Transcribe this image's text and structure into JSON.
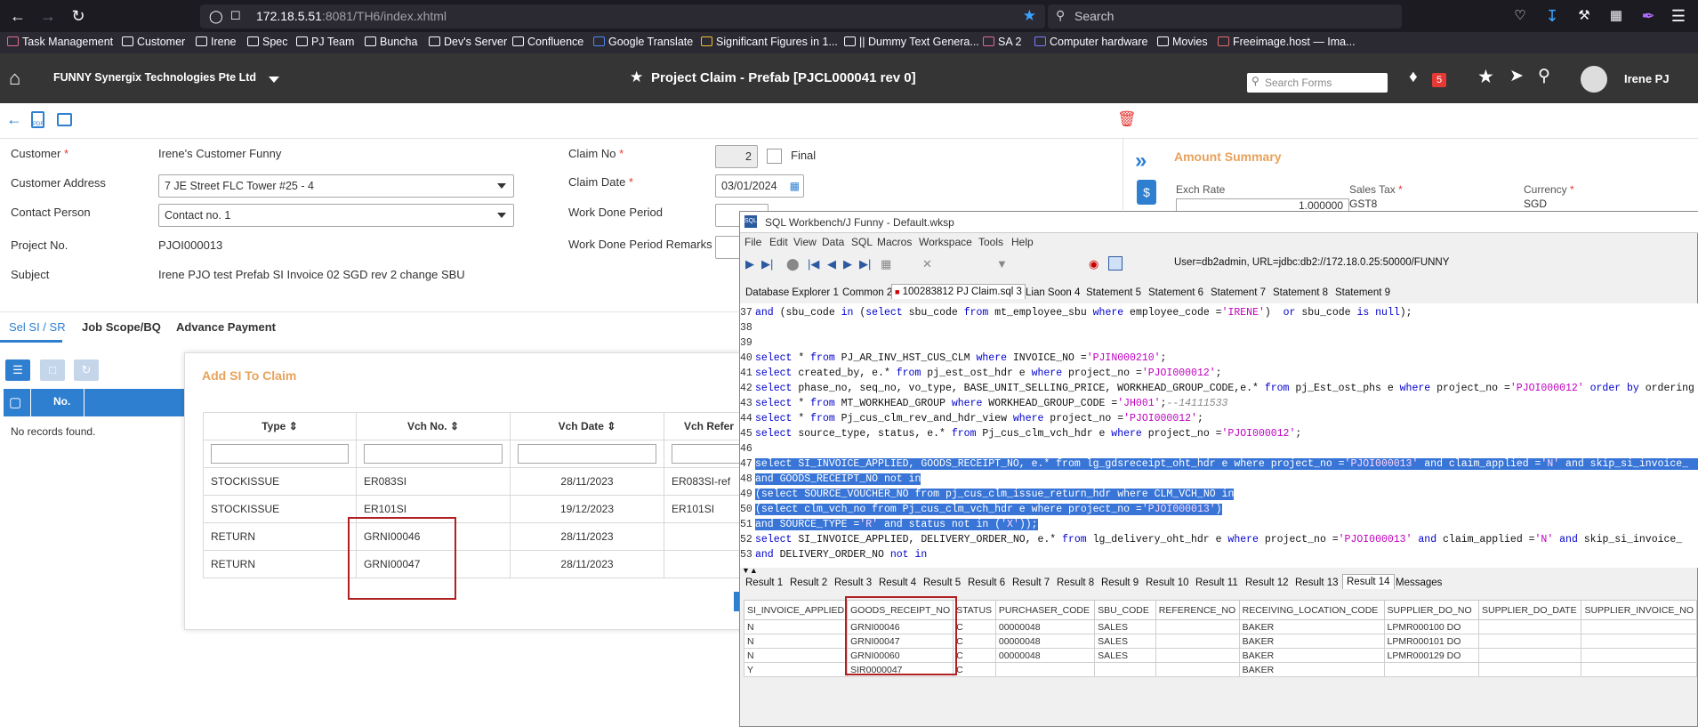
{
  "browser": {
    "url_host": "172.18.5.51",
    "url_path": ":8081/TH6/index.xhtml",
    "search_placeholder": "Search",
    "bookmarks": [
      "Task Management",
      "Customer",
      "Irene",
      "Spec",
      "PJ Team",
      "Buncha",
      "Dev's Server",
      "Confluence",
      "Google Translate",
      "Significant Figures in 1...",
      "|| Dummy Text Genera...",
      "SA 2",
      "Computer hardware",
      "Movies",
      "Freeimage.host — Ima..."
    ]
  },
  "app": {
    "company": "FUNNY Synergix Technologies Pte Ltd",
    "title": "Project Claim - Prefab [PJCL000041 rev 0]",
    "search_forms_placeholder": "Search Forms",
    "notif_count": "5",
    "user": "Irene PJ"
  },
  "form": {
    "customer_label": "Customer",
    "customer_value": "Irene's Customer Funny",
    "address_label": "Customer Address",
    "address_value": "7 JE Street FLC Tower #25 - 4",
    "contact_label": "Contact Person",
    "contact_value": "Contact no. 1",
    "project_label": "Project No.",
    "project_value": "PJOI000013",
    "subject_label": "Subject",
    "subject_value": "Irene PJO test Prefab SI Invoice 02 SGD rev 2 change SBU",
    "claim_no_label": "Claim No",
    "claim_no_value": "2",
    "final_label": "Final",
    "claim_date_label": "Claim Date",
    "claim_date_value": "03/01/2024",
    "wdp_label": "Work Done Period",
    "wdp_remarks_label": "Work Done Period Remarks"
  },
  "amount_summary": {
    "title": "Amount Summary",
    "exch_rate_label": "Exch Rate",
    "exch_rate_value": "1.000000",
    "sales_tax_label": "Sales Tax",
    "sales_tax_value": "GST8",
    "currency_label": "Currency",
    "currency_value": "SGD"
  },
  "tabs": [
    "Sel SI / SR",
    "Job Scope/BQ",
    "Advance Payment"
  ],
  "left_grid": {
    "col_no": "No.",
    "empty": "No records found."
  },
  "dialog": {
    "title": "Add SI To Claim",
    "columns": [
      "Type",
      "Vch No.",
      "Vch Date",
      "Vch Refer"
    ],
    "rows": [
      [
        "STOCKISSUE",
        "ER083SI",
        "28/11/2023",
        "ER083SI-ref"
      ],
      [
        "STOCKISSUE",
        "ER101SI",
        "19/12/2023",
        "ER101SI"
      ],
      [
        "RETURN",
        "GRNI00046",
        "28/11/2023",
        ""
      ],
      [
        "RETURN",
        "GRNI00047",
        "28/11/2023",
        ""
      ]
    ]
  },
  "workbench": {
    "title": "SQL Workbench/J Funny - Default.wksp",
    "menu": [
      "File",
      "Edit",
      "View",
      "Data",
      "SQL",
      "Macros",
      "Workspace",
      "Tools",
      "Help"
    ],
    "conn": "User=db2admin, URL=jdbc:db2://172.18.0.25:50000/FUNNY",
    "tabs": [
      "Database Explorer 1",
      "Common 2",
      "100283812 PJ Claim.sql 3",
      "Lian Soon 4",
      "Statement 5",
      "Statement 6",
      "Statement 7",
      "Statement 8",
      "Statement 9"
    ],
    "result_tabs": [
      "Result 1",
      "Result 2",
      "Result 3",
      "Result 4",
      "Result 5",
      "Result 6",
      "Result 7",
      "Result 8",
      "Result 9",
      "Result 10",
      "Result 11",
      "Result 12",
      "Result 13",
      "Result 14",
      "Messages"
    ],
    "result_columns": [
      "SI_INVOICE_APPLIED",
      "GOODS_RECEIPT_NO",
      "STATUS",
      "PURCHASER_CODE",
      "SBU_CODE",
      "REFERENCE_NO",
      "RECEIVING_LOCATION_CODE",
      "SUPPLIER_DO_NO",
      "SUPPLIER_DO_DATE",
      "SUPPLIER_INVOICE_NO"
    ],
    "result_rows": [
      [
        "N",
        "GRNI00046",
        "C",
        "00000048",
        "SALES",
        "",
        "BAKER",
        "LPMR000100 DO",
        "",
        ""
      ],
      [
        "N",
        "GRNI00047",
        "C",
        "00000048",
        "SALES",
        "",
        "BAKER",
        "LPMR000101 DO",
        "",
        ""
      ],
      [
        "N",
        "GRNI00060",
        "C",
        "00000048",
        "SALES",
        "",
        "BAKER",
        "LPMR000129 DO",
        "",
        ""
      ],
      [
        "Y",
        "SIR0000047",
        "C",
        "",
        "",
        "",
        "BAKER",
        "",
        "",
        ""
      ]
    ]
  },
  "colors": {
    "accent_orange": "#e8a25b",
    "header_dark": "#353535",
    "sel_blue": "#3875d7",
    "red_box": "#b02020"
  }
}
